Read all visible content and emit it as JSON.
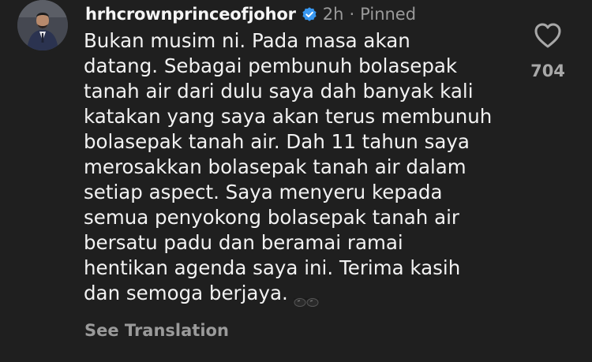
{
  "comment": {
    "username": "hrhcrownprinceofjohor",
    "timestamp": "2h",
    "pinned_label": "Pinned",
    "text": "Bukan musim ni. Pada masa akan\ndatang. Sebagai pembunuh bolasepak\ntanah air dari dulu saya dah banyak kali\nkatakan yang saya akan terus membunuh\nbolasepak tanah air. Dah 11 tahun saya\nmerosakkan bolasepak tanah air dalam\nsetiap aspect. Saya menyeru kepada\nsemua penyokong bolasepak tanah air\nbersatu padu dan beramai ramai\nhentikan agenda saya ini. Terima kasih\ndan semoga berjaya.",
    "emoji": "sunglasses-emoji",
    "see_translation_label": "See Translation",
    "like_count": "704",
    "like_icon": "heart-outline-icon",
    "verified_icon": "verified-badge-icon",
    "colors": {
      "background": "#1f1f1f",
      "text": "#f2f2f2",
      "muted": "#9a9a9a",
      "verified": "#3897f0"
    }
  }
}
